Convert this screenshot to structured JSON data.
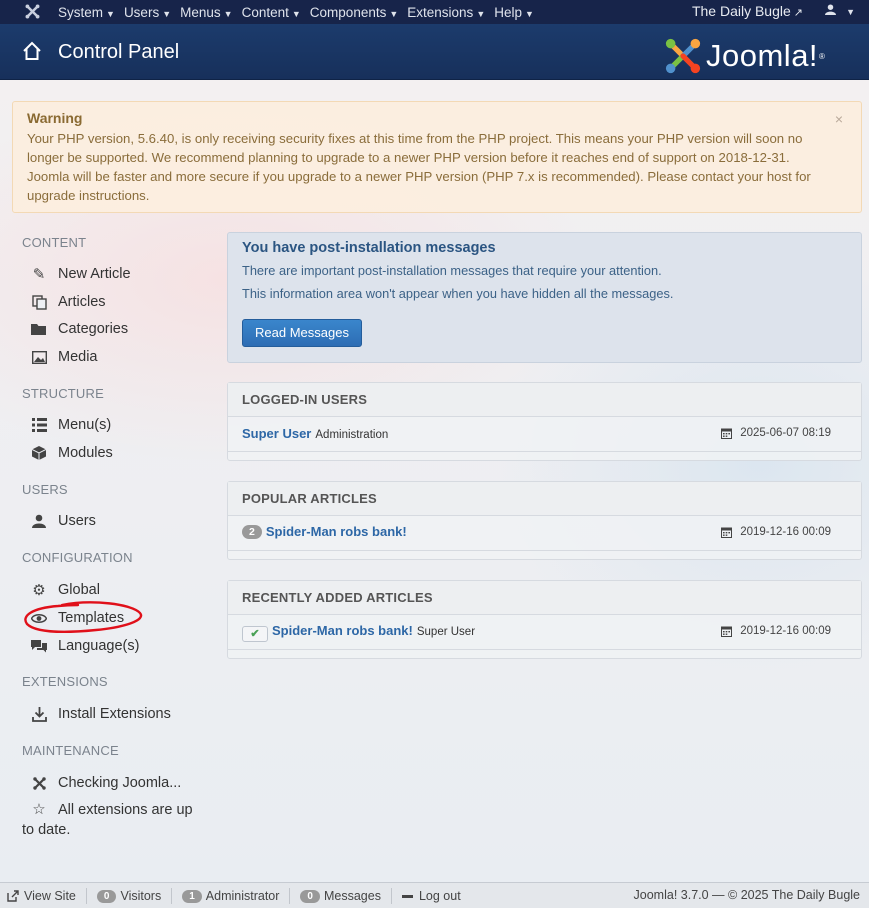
{
  "navbar": {
    "menu": [
      "System",
      "Users",
      "Menus",
      "Content",
      "Components",
      "Extensions",
      "Help"
    ],
    "site_name": "The Daily Bugle"
  },
  "header": {
    "title": "Control Panel",
    "logo_text": "Joomla!"
  },
  "warning": {
    "title": "Warning",
    "text": "Your PHP version, 5.6.40, is only receiving security fixes at this time from the PHP project. This means your PHP version will soon no longer be supported. We recommend planning to upgrade to a newer PHP version before it reaches end of support on 2018-12-31. Joomla will be faster and more secure if you upgrade to a newer PHP version (PHP 7.x is recommended). Please contact your host for upgrade instructions.",
    "close": "×"
  },
  "sidebar": {
    "content_head": "CONTENT",
    "new_article": "New Article",
    "articles": "Articles",
    "categories": "Categories",
    "media": "Media",
    "structure_head": "STRUCTURE",
    "menus": "Menu(s)",
    "modules": "Modules",
    "users_head": "USERS",
    "users": "Users",
    "config_head": "CONFIGURATION",
    "global": "Global",
    "templates": "Templates",
    "languages": "Language(s)",
    "extensions_head": "EXTENSIONS",
    "install_extensions": "Install Extensions",
    "maintenance_head": "MAINTENANCE",
    "checking": "Checking Joomla...",
    "uptodate": "All extensions are up to date."
  },
  "postinstall": {
    "title": "You have post-installation messages",
    "text1": "There are important post-installation messages that require your attention.",
    "text2": "This information area won't appear when you have hidden all the messages.",
    "button": "Read Messages"
  },
  "logged_in": {
    "title": "LOGGED-IN USERS",
    "user": "Super User",
    "location": "Administration",
    "date": "2025-06-07 08:19"
  },
  "popular": {
    "title": "POPULAR ARTICLES",
    "hits": "2",
    "article": "Spider-Man robs bank!",
    "date": "2019-12-16 00:09"
  },
  "recent": {
    "title": "RECENTLY ADDED ARTICLES",
    "article": "Spider-Man robs bank!",
    "author": "Super User",
    "date": "2019-12-16 00:09"
  },
  "footer": {
    "view_site": "View Site",
    "visitors_count": "0",
    "visitors": "Visitors",
    "admin_count": "1",
    "admin": "Administrator",
    "messages_count": "0",
    "messages": "Messages",
    "logout": "Log out",
    "copyright": "Joomla! 3.7.0 — © 2025 The Daily Bugle"
  },
  "colors": {
    "navbar": "#17244a",
    "header": "#1a3867",
    "link": "#2d67a6",
    "primary_button": "#2d6db4",
    "warning_bg": "#fcefdc",
    "annotation": "#e0101a"
  }
}
